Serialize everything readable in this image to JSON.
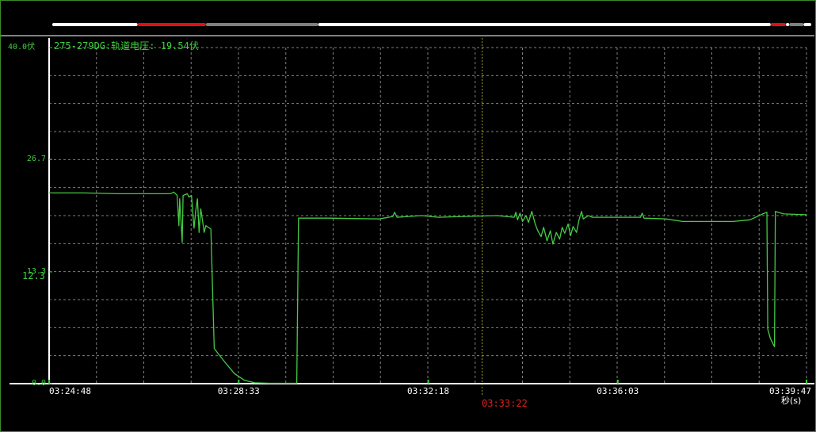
{
  "reading": "275-279DG:轨道电压: 19.54伏",
  "cursor_time": "03:33:22",
  "marker_value": "12.3",
  "x_unit": "秒(s)",
  "colors": {
    "background": "#000000",
    "signal": "#44cc44",
    "axis": "#ffffff",
    "grid": "#808080",
    "cursor": "#a0a020",
    "cursor_label": "#e02020",
    "timebar_normal": "#ffffff",
    "timebar_alarm": "#e01010",
    "timebar_gap": "#808080"
  },
  "timebar": [
    {
      "from": "03:24:48",
      "to": "03:26:29",
      "state": "normal"
    },
    {
      "from": "03:26:29",
      "to": "03:27:50",
      "state": "alarm"
    },
    {
      "from": "03:27:50",
      "to": "03:30:03",
      "state": "gap"
    },
    {
      "from": "03:30:03",
      "to": "03:38:59",
      "state": "normal"
    },
    {
      "from": "03:38:59",
      "to": "03:39:17",
      "state": "alarm"
    },
    {
      "from": "03:39:17",
      "to": "03:39:21",
      "state": "normal"
    },
    {
      "from": "03:39:21",
      "to": "03:39:38",
      "state": "gap"
    },
    {
      "from": "03:39:38",
      "to": "03:39:47",
      "state": "normal"
    }
  ],
  "chart_data": {
    "type": "line",
    "title": "",
    "xlabel": "秒(s)",
    "ylabel": "",
    "ylim": [
      0,
      40
    ],
    "xlim": [
      "03:24:48",
      "03:39:47"
    ],
    "y_ticks": [
      {
        "value": 0,
        "label": "0.0"
      },
      {
        "value": 13.3,
        "label": "13.3"
      },
      {
        "value": 26.7,
        "label": "26.7"
      },
      {
        "value": 40,
        "label": "40.0伏"
      }
    ],
    "x_ticks": [
      "03:24:48",
      "03:28:33",
      "03:32:18",
      "03:36:03",
      "03:39:47"
    ],
    "grid": true,
    "cursor_x": "03:33:22",
    "series": [
      {
        "points": [
          [
            "03:24:48",
            22.7
          ],
          [
            "03:25:30",
            22.7
          ],
          [
            "03:26:10",
            22.6
          ],
          [
            "03:27:12",
            22.6
          ],
          [
            "03:27:16",
            22.8
          ],
          [
            "03:27:20",
            22.4
          ],
          [
            "03:27:22",
            18.8
          ],
          [
            "03:27:23",
            22.0
          ],
          [
            "03:27:26",
            16.8
          ],
          [
            "03:27:27",
            22.4
          ],
          [
            "03:27:32",
            22.6
          ],
          [
            "03:27:34",
            22.2
          ],
          [
            "03:27:37",
            22.4
          ],
          [
            "03:27:40",
            18.5
          ],
          [
            "03:27:42",
            20.5
          ],
          [
            "03:27:44",
            22.0
          ],
          [
            "03:27:46",
            18.0
          ],
          [
            "03:27:48",
            20.8
          ],
          [
            "03:27:50",
            19.5
          ],
          [
            "03:27:52",
            18.0
          ],
          [
            "03:27:54",
            18.8
          ],
          [
            "03:28:00",
            18.4
          ],
          [
            "03:28:04",
            4.2
          ],
          [
            "03:28:10",
            3.4
          ],
          [
            "03:28:18",
            2.4
          ],
          [
            "03:28:28",
            1.2
          ],
          [
            "03:28:40",
            0.4
          ],
          [
            "03:28:52",
            0.1
          ],
          [
            "03:29:10",
            0.05
          ],
          [
            "03:29:42",
            0.05
          ],
          [
            "03:29:44",
            19.7
          ],
          [
            "03:30:20",
            19.7
          ],
          [
            "03:31:20",
            19.6
          ],
          [
            "03:31:36",
            19.9
          ],
          [
            "03:31:38",
            20.4
          ],
          [
            "03:31:41",
            19.8
          ],
          [
            "03:32:10",
            20.0
          ],
          [
            "03:32:30",
            19.8
          ],
          [
            "03:33:00",
            19.9
          ],
          [
            "03:33:40",
            20.0
          ],
          [
            "03:34:00",
            19.8
          ],
          [
            "03:34:02",
            20.4
          ],
          [
            "03:34:04",
            19.5
          ],
          [
            "03:34:07",
            20.3
          ],
          [
            "03:34:10",
            19.3
          ],
          [
            "03:34:14",
            20.0
          ],
          [
            "03:34:17",
            19.2
          ],
          [
            "03:34:21",
            20.5
          ],
          [
            "03:34:25",
            19.0
          ],
          [
            "03:34:28",
            18.2
          ],
          [
            "03:34:32",
            17.5
          ],
          [
            "03:34:35",
            18.6
          ],
          [
            "03:34:39",
            17.0
          ],
          [
            "03:34:43",
            18.2
          ],
          [
            "03:34:46",
            16.6
          ],
          [
            "03:34:50",
            18.0
          ],
          [
            "03:34:54",
            17.2
          ],
          [
            "03:34:57",
            18.6
          ],
          [
            "03:35:00",
            17.9
          ],
          [
            "03:35:04",
            19.0
          ],
          [
            "03:35:07",
            17.6
          ],
          [
            "03:35:10",
            18.7
          ],
          [
            "03:35:14",
            18.0
          ],
          [
            "03:35:17",
            19.5
          ],
          [
            "03:35:20",
            20.5
          ],
          [
            "03:35:22",
            19.6
          ],
          [
            "03:35:28",
            20.0
          ],
          [
            "03:35:33",
            19.8
          ],
          [
            "03:36:30",
            19.8
          ],
          [
            "03:36:32",
            20.3
          ],
          [
            "03:36:34",
            19.7
          ],
          [
            "03:37:00",
            19.6
          ],
          [
            "03:37:20",
            19.3
          ],
          [
            "03:38:20",
            19.3
          ],
          [
            "03:38:40",
            19.5
          ],
          [
            "03:38:55",
            20.2
          ],
          [
            "03:39:00",
            20.4
          ],
          [
            "03:39:01",
            6.5
          ],
          [
            "03:39:04",
            5.4
          ],
          [
            "03:39:09",
            4.4
          ],
          [
            "03:39:10",
            20.5
          ],
          [
            "03:39:20",
            20.2
          ],
          [
            "03:39:47",
            20.1
          ]
        ]
      }
    ]
  }
}
